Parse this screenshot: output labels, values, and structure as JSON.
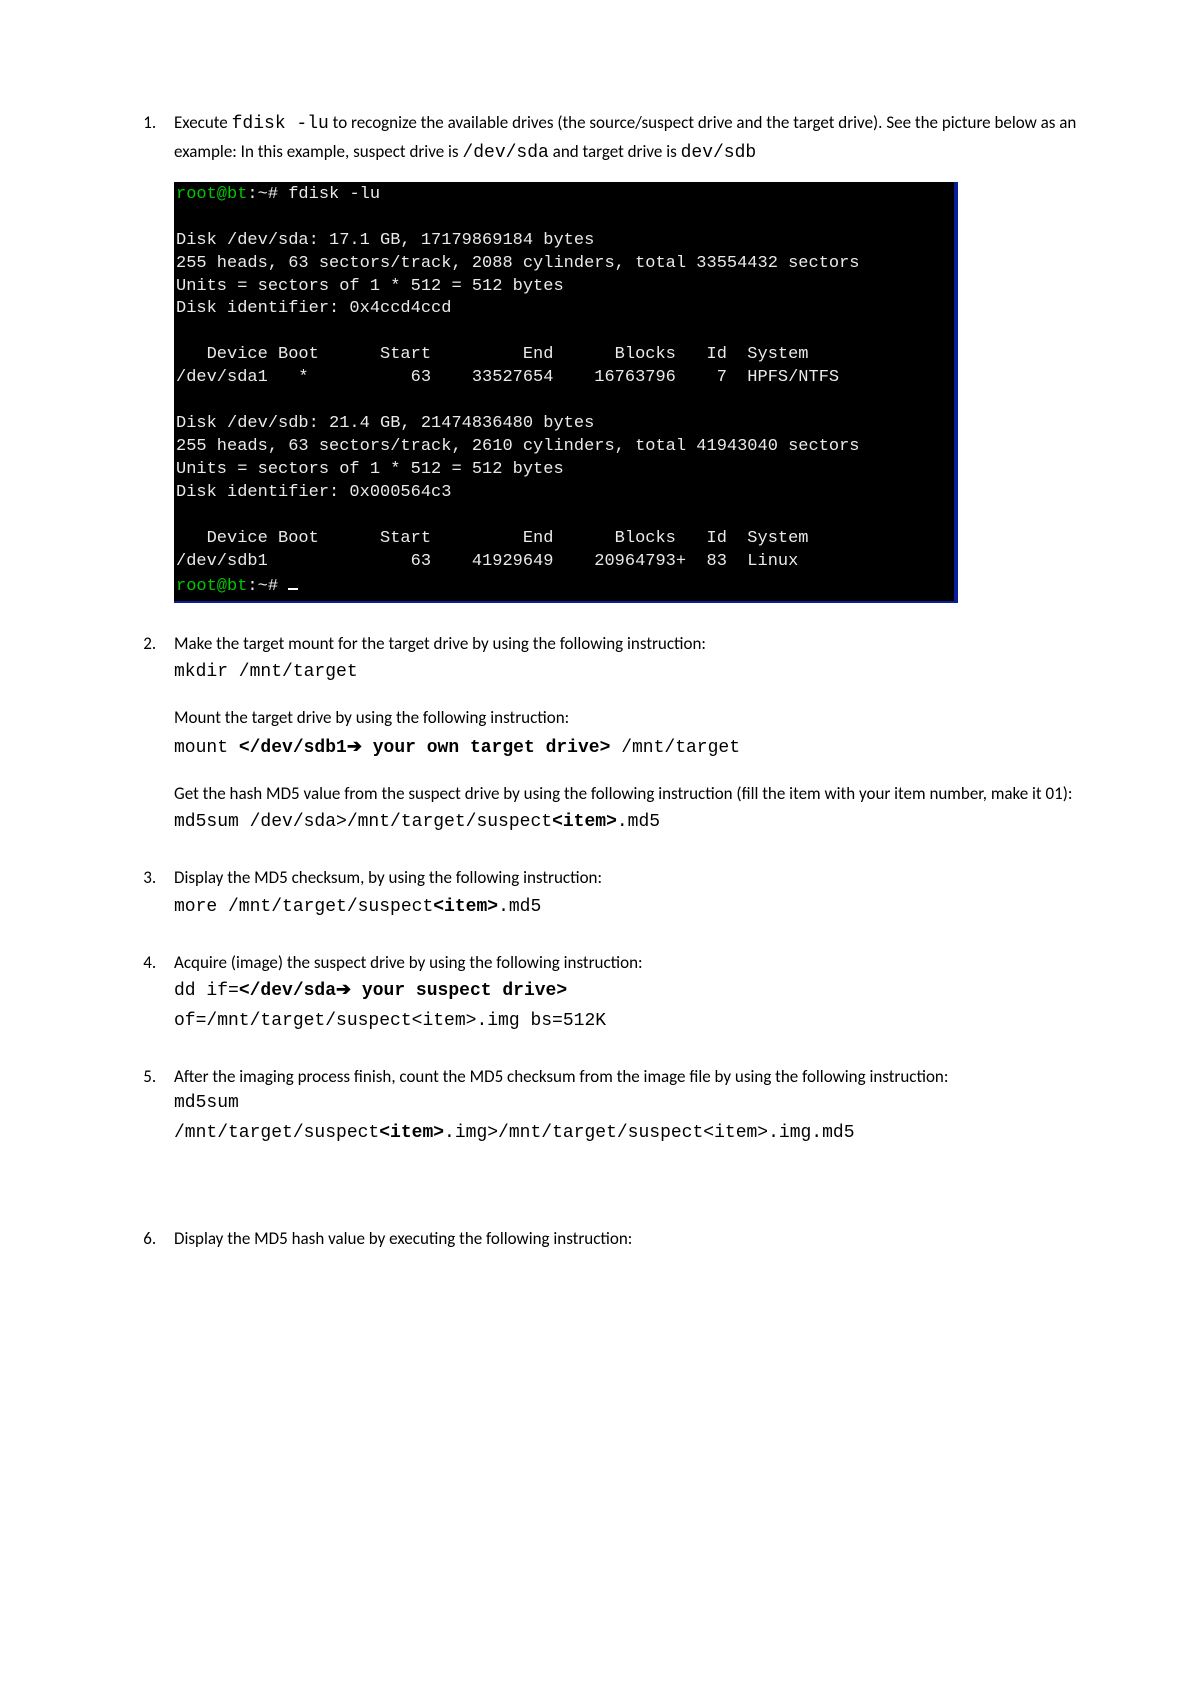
{
  "steps": {
    "s1": {
      "text_a": "Execute ",
      "cmd_a": "fdisk -lu",
      "text_b": " to recognize the available drives (the source/suspect drive and the target drive). See the picture below as an example: In this example, suspect drive is ",
      "cmd_b": "/dev/sda",
      "text_c": " and target drive is ",
      "cmd_c": "dev/sdb"
    },
    "s2": {
      "p1": "Make the target mount for the target drive by using the following instruction:",
      "cmd1": "mkdir /mnt/target",
      "p2": "Mount the target drive by using the following instruction:",
      "cmd2_a": "mount ",
      "cmd2_b": "</dev/sdb1",
      "cmd2_arrow": "➔",
      "cmd2_c": " your own target drive>",
      "cmd2_d": " /mnt/target",
      "p3": "Get the hash MD5 value from the suspect drive by using the following instruction (fill the item with your item number, make it 01):",
      "cmd3_a": "md5sum /dev/sda>/mnt/target/suspect",
      "cmd3_b": "<item>",
      "cmd3_c": ".md5"
    },
    "s3": {
      "p1": "Display the MD5 checksum, by using the following instruction:",
      "cmd_a": "more /mnt/target/suspect",
      "cmd_b": "<item>",
      "cmd_c": ".md5"
    },
    "s4": {
      "p1": "Acquire (image) the suspect drive by using the following instruction:",
      "cmd1_a": "dd if=",
      "cmd1_b": "</dev/sda",
      "cmd1_arrow": "➔",
      "cmd1_c": " your suspect drive>",
      "cmd2": "of=/mnt/target/suspect<item>.img bs=512K"
    },
    "s5": {
      "p1": "After the imaging process finish, count the MD5 checksum from the image file by using the following instruction:",
      "cmd1": "md5sum",
      "cmd2_a": "/mnt/target/suspect",
      "cmd2_b": "<item>",
      "cmd2_c": ".img>/mnt/target/suspect<item>.img.md5"
    },
    "s6": {
      "p1": "Display the MD5 hash value by executing the following instruction:"
    }
  },
  "terminal": {
    "prompt1a": "root@bt",
    "prompt1b": ":~# fdisk -lu",
    "diskA": "Disk /dev/sda: 17.1 GB, 17179869184 bytes\n255 heads, 63 sectors/track, 2088 cylinders, total 33554432 sectors\nUnits = sectors of 1 * 512 = 512 bytes\nDisk identifier: 0x4ccd4ccd",
    "headerA": "   Device Boot      Start         End      Blocks   Id  System",
    "rowA": "/dev/sda1   *          63    33527654    16763796    7  HPFS/NTFS",
    "diskB": "Disk /dev/sdb: 21.4 GB, 21474836480 bytes\n255 heads, 63 sectors/track, 2610 cylinders, total 41943040 sectors\nUnits = sectors of 1 * 512 = 512 bytes\nDisk identifier: 0x000564c3",
    "headerB": "   Device Boot      Start         End      Blocks   Id  System",
    "rowB": "/dev/sdb1              63    41929649    20964793+  83  Linux",
    "prompt2a": "root@bt",
    "prompt2b": ":~# "
  }
}
